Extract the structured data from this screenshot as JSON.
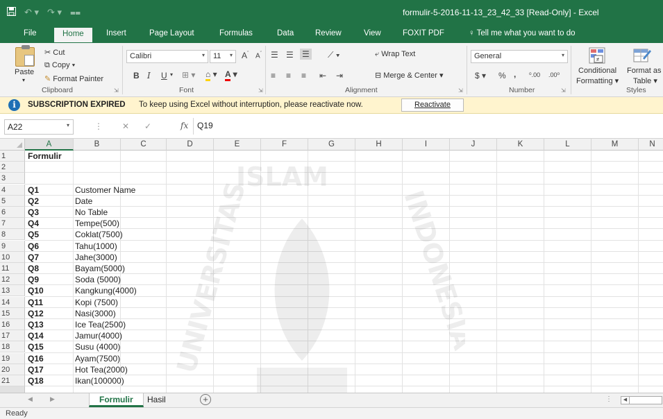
{
  "window": {
    "title": "formulir-5-2016-11-13_23_42_33  [Read-Only]  -  Excel"
  },
  "ribbon_tabs": [
    "File",
    "Home",
    "Insert",
    "Page Layout",
    "Formulas",
    "Data",
    "Review",
    "View",
    "FOXIT PDF"
  ],
  "tell_me": "Tell me what you want to do",
  "clipboard": {
    "paste": "Paste",
    "cut": "Cut",
    "copy": "Copy",
    "format_painter": "Format Painter",
    "group": "Clipboard"
  },
  "font": {
    "name": "Calibri",
    "size": "11",
    "group": "Font",
    "bold": "B",
    "italic": "I",
    "underline": "U"
  },
  "alignment": {
    "wrap_text": "Wrap Text",
    "merge_center": "Merge & Center",
    "group": "Alignment"
  },
  "number": {
    "format": "General",
    "currency": "$",
    "percent": "%",
    "comma": ",",
    "group": "Number"
  },
  "styles": {
    "conditional_line1": "Conditional",
    "conditional_line2": "Formatting",
    "format_as_line1": "Format as",
    "format_as_line2": "Table",
    "group": "Styles"
  },
  "message_bar": {
    "heading": "SUBSCRIPTION EXPIRED",
    "text": "To keep using Excel without interruption, please reactivate now.",
    "button": "Reactivate"
  },
  "formula_bar": {
    "name_box": "A22",
    "fx": "fx",
    "value": "Q19"
  },
  "columns": [
    "A",
    "B",
    "C",
    "D",
    "E",
    "F",
    "G",
    "H",
    "I",
    "J",
    "K",
    "L",
    "M",
    "N"
  ],
  "rows": [
    {
      "num": "1",
      "a": "Formulir",
      "b": ""
    },
    {
      "num": "2",
      "a": "",
      "b": ""
    },
    {
      "num": "3",
      "a": "",
      "b": ""
    },
    {
      "num": "4",
      "a": "Q1",
      "b": "Customer Name"
    },
    {
      "num": "5",
      "a": "Q2",
      "b": "Date"
    },
    {
      "num": "6",
      "a": "Q3",
      "b": "No Table"
    },
    {
      "num": "7",
      "a": "Q4",
      "b": "Tempe(500)"
    },
    {
      "num": "8",
      "a": "Q5",
      "b": "Coklat(7500)"
    },
    {
      "num": "9",
      "a": "Q6",
      "b": "Tahu(1000)"
    },
    {
      "num": "10",
      "a": "Q7",
      "b": "Jahe(3000)"
    },
    {
      "num": "11",
      "a": "Q8",
      "b": "Bayam(5000)"
    },
    {
      "num": "12",
      "a": "Q9",
      "b": "Soda (5000)"
    },
    {
      "num": "13",
      "a": "Q10",
      "b": "Kangkung(4000)"
    },
    {
      "num": "14",
      "a": "Q11",
      "b": "Kopi (7500)"
    },
    {
      "num": "15",
      "a": "Q12",
      "b": "Nasi(3000)"
    },
    {
      "num": "16",
      "a": "Q13",
      "b": "Ice Tea(2500)"
    },
    {
      "num": "17",
      "a": "Q14",
      "b": "Jamur(4000)"
    },
    {
      "num": "18",
      "a": "Q15",
      "b": "Susu (4000)"
    },
    {
      "num": "19",
      "a": "Q16",
      "b": "Ayam(7500)"
    },
    {
      "num": "20",
      "a": "Q17",
      "b": "Hot Tea(2000)"
    },
    {
      "num": "21",
      "a": "Q18",
      "b": "Ikan(100000)"
    }
  ],
  "sheets": [
    "Formulir",
    "Hasil"
  ],
  "status": "Ready",
  "watermark_text": {
    "top": "ISLAM",
    "left": "UNIVERSITAS",
    "right": "INDONESIA"
  },
  "colors": {
    "excel_green": "#217346",
    "message_bg": "#fff4ce"
  }
}
